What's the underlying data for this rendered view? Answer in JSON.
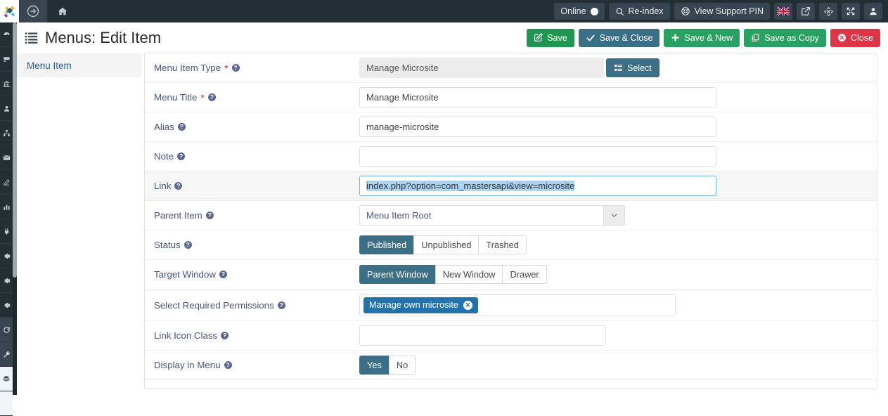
{
  "topbar": {
    "logo_icon": "joomla-logo-icon",
    "toggle_icon": "arrow-circle-right-icon",
    "home_icon": "home-icon",
    "online": {
      "label": "Online",
      "icon": "status-dot-icon"
    },
    "reindex": {
      "label": "Re-index",
      "icon": "search-icon"
    },
    "support_pin": {
      "label": "View Support PIN",
      "icon": "lifebuoy-icon"
    },
    "flag_icon": "uk-flag-icon",
    "preview_icon": "external-link-icon",
    "joomla_icon": "joomla-mark-icon",
    "fullscreen_icon": "expand-arrows-icon",
    "user_icon": "user-icon"
  },
  "header": {
    "title": "Menus: Edit Item",
    "title_icon": "list-icon",
    "toolbar": [
      {
        "label": "Save",
        "icon": "edit-square-icon",
        "style": "green"
      },
      {
        "label": "Save & Close",
        "icon": "check-icon",
        "style": "teal"
      },
      {
        "label": "Save & New",
        "icon": "plus-icon",
        "style": "green2"
      },
      {
        "label": "Save as Copy",
        "icon": "copy-icon",
        "style": "green3"
      },
      {
        "label": "Close",
        "icon": "close-circle-icon",
        "style": "red"
      }
    ]
  },
  "tabs": [
    {
      "label": "Menu Item",
      "active": true
    }
  ],
  "form": {
    "menu_item_type": {
      "label": "Menu Item Type",
      "required": true,
      "help": "?",
      "value": "Manage Microsite",
      "select_button": "Select",
      "select_icon": "list-ul-icon"
    },
    "menu_title": {
      "label": "Menu Title",
      "required": true,
      "help": "?",
      "value": "Manage Microsite",
      "placeholder": ""
    },
    "alias": {
      "label": "Alias",
      "help": "?",
      "value": "manage-microsite",
      "placeholder": ""
    },
    "note": {
      "label": "Note",
      "help": "?",
      "value": "",
      "placeholder": ""
    },
    "link": {
      "label": "Link",
      "help": "?",
      "value": "index.php?option=com_mastersapi&view=microsite",
      "selected": true
    },
    "parent_item": {
      "label": "Parent Item",
      "help": "?",
      "value": "Menu Item Root",
      "caret_icon": "chevron-down-icon"
    },
    "status": {
      "label": "Status",
      "help": "?",
      "options": [
        "Published",
        "Unpublished",
        "Trashed"
      ],
      "selected": "Published"
    },
    "target_window": {
      "label": "Target Window",
      "help": "?",
      "options": [
        "Parent Window",
        "New Window",
        "Drawer"
      ],
      "selected": "Parent Window"
    },
    "permissions": {
      "label": "Select Required Permissions",
      "help": "?",
      "tags": [
        {
          "label": "Manage own microsite",
          "remove_icon": "remove-tag-icon"
        }
      ]
    },
    "link_icon_class": {
      "label": "Link Icon Class",
      "help": "?",
      "value": "",
      "placeholder": ""
    },
    "display_in_menu": {
      "label": "Display in Menu",
      "help": "?",
      "options": [
        "Yes",
        "No"
      ],
      "selected": "Yes"
    }
  },
  "rail": {
    "items": [
      "dashboard-icon",
      "content-icon",
      "bank-icon",
      "users-icon",
      "sitemap-icon",
      "mail-icon",
      "edit-icon",
      "chart-icon",
      "plug-icon",
      "gear-icon",
      "gear-alt-icon",
      "gear-alt2-icon",
      "refresh-icon",
      "wrench-icon",
      "box-icon",
      "blank-icon"
    ]
  },
  "colors": {
    "topbar_bg": "#242e35",
    "accent_teal": "#3a6f85",
    "accent_green": "#219653",
    "accent_red": "#dc3545",
    "tag_blue": "#2273ab",
    "label_text": "#4a5578",
    "selection_blue": "#aad4f5"
  }
}
